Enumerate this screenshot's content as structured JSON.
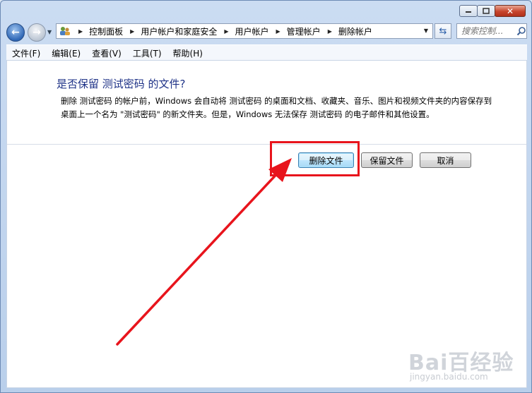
{
  "window": {
    "controls": {
      "minimize": "▭",
      "maximize": "▢",
      "close": "✕"
    }
  },
  "nav": {
    "back_icon": "back-arrow-icon",
    "forward_icon": "forward-arrow-icon",
    "breadcrumbs": [
      "控制面板",
      "用户帐户和家庭安全",
      "用户帐户",
      "管理帐户",
      "删除帐户"
    ],
    "search_placeholder": "搜索控制..."
  },
  "menu": [
    "文件(F)",
    "编辑(E)",
    "查看(V)",
    "工具(T)",
    "帮助(H)"
  ],
  "dialog": {
    "heading": "是否保留 测试密码 的文件?",
    "description": "删除 测试密码 的帐户前，Windows 会自动将 测试密码 的桌面和文档、收藏夹、音乐、图片和视频文件夹的内容保存到桌面上一个名为 \"测试密码\" 的新文件夹。但是，Windows 无法保存 测试密码 的电子邮件和其他设置。",
    "buttons": {
      "delete_files": "删除文件",
      "keep_files": "保留文件",
      "cancel": "取消"
    }
  },
  "annotation": {
    "highlight_color": "#e8141c"
  },
  "watermark": {
    "logo": "Bai百经验",
    "url": "jingyan.baidu.com"
  }
}
